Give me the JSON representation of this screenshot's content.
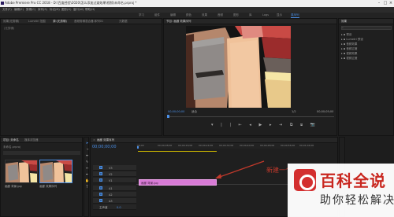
{
  "titlebar": {
    "title": "Adobe Premiere Pro CC 2018 - D:\\百度经验\\2020\\怎么添加过渡效果\\视频\\未命名.prproj *"
  },
  "menubar": {
    "items": [
      "文件(F)",
      "编辑(E)",
      "剪辑(C)",
      "序列(S)",
      "标记(M)",
      "图形(G)",
      "窗口(W)",
      "帮助(H)"
    ]
  },
  "workspaces": {
    "items": [
      "学习",
      "组件",
      "编辑",
      "颜色",
      "效果",
      "音频",
      "图形",
      "库",
      "Logs",
      "显示",
      "原序列"
    ]
  },
  "source_panel": {
    "tabs": [
      "效果(无剪辑)",
      "Lumetri 范围",
      "源:(无剪辑)",
      "音频剪辑混合器:序列01",
      "元数据"
    ],
    "empty_label": "(无剪辑)"
  },
  "program": {
    "tab": "节目: 画廊 效果序列",
    "timecode_left": "00;00;00;00",
    "fit_label": "适合",
    "quality_label": "1/2",
    "timecode_right": "00;00;05;00"
  },
  "effects_panel": {
    "tab": "效果",
    "search_placeholder": "",
    "items": [
      "预设",
      "Lumetri 预设",
      "音频效果",
      "音频过渡",
      "视频效果",
      "视频过渡"
    ]
  },
  "project": {
    "tabs": [
      "项目: 未命名",
      "媒体浏览器"
    ],
    "path": "未命名.prproj",
    "thumbs": [
      {
        "label": "画廊 背景.jpg"
      },
      {
        "label": "画廊 效果序列"
      }
    ]
  },
  "timeline": {
    "tab": "画廊 效果序列",
    "timecode": "00;00;00;00",
    "ruler": [
      "00;00",
      "00;00;08;00",
      "00;00;16;00",
      "00;00;24;00",
      "00;00;32;00",
      "00;00;40;00",
      "00;00;48;00",
      "00;00;56;00",
      "00;01;04;00"
    ],
    "tracks": [
      {
        "id": "V3"
      },
      {
        "id": "V2"
      },
      {
        "id": "V1"
      },
      {
        "id": "A1"
      },
      {
        "id": "A2"
      },
      {
        "id": "A3"
      }
    ],
    "clip_label": "画廊 背景.jpg",
    "master_label": "主声道",
    "master_value": "0.0"
  },
  "annotation": {
    "text": "新建一个"
  },
  "watermark": {
    "title": "百科全说",
    "subtitle": "助你轻松解决"
  },
  "colors": {
    "accent": "#4a8fe7",
    "clip": "#d87bd6",
    "arrow": "#c0392b",
    "watermark_red": "#c9271f"
  }
}
